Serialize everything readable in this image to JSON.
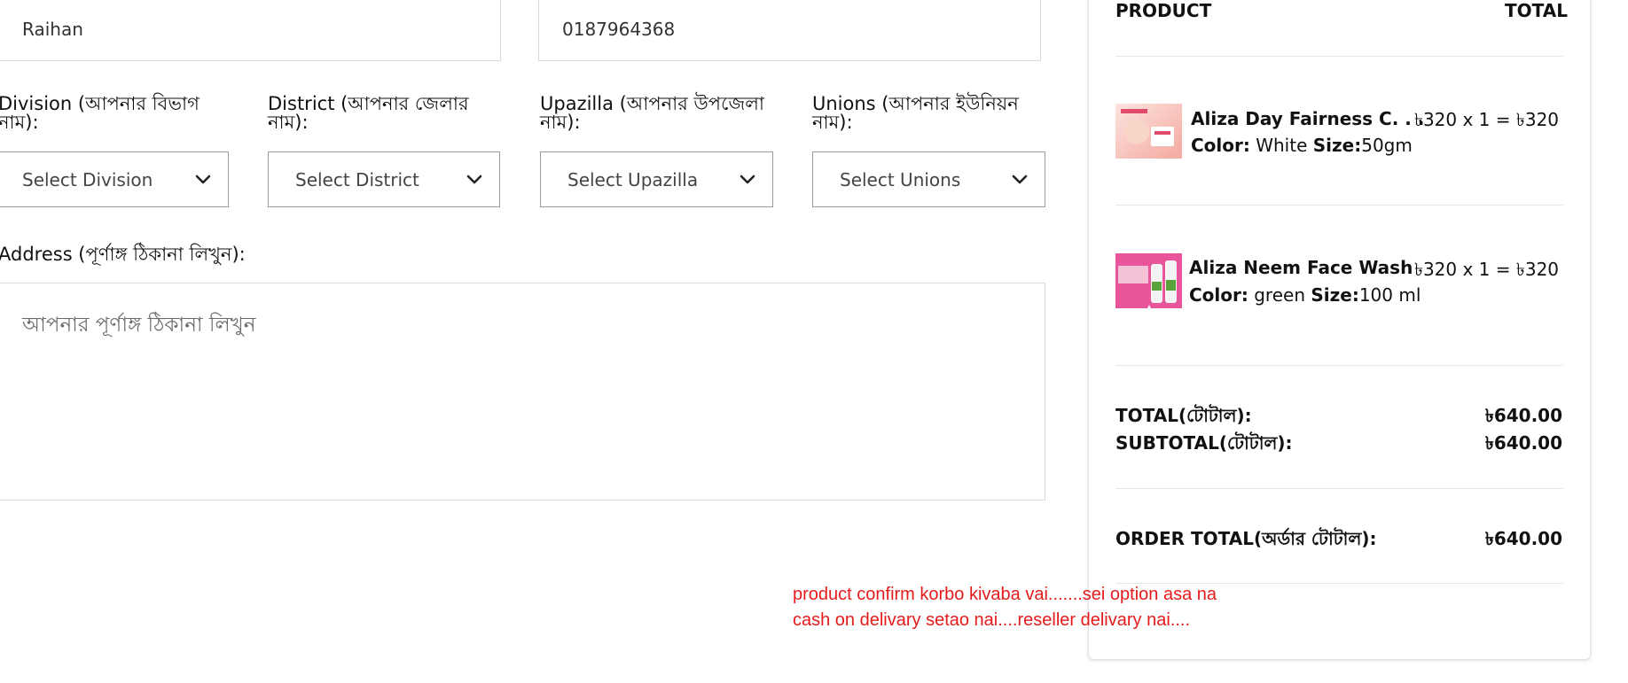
{
  "form": {
    "name_value": "Raihan",
    "phone_value": "0187964368",
    "division_label_1": "Division (আপনার বিভাগ",
    "division_label_2": "নাম):",
    "district_label_1": "District (আপনার জেলার",
    "district_label_2": "নাম):",
    "upazilla_label_1": "Upazilla (আপনার উপজেলা",
    "upazilla_label_2": "নাম):",
    "unions_label_1": "Unions (আপনার ইউনিয়ন",
    "unions_label_2": "নাম):",
    "division_select": "Select Division",
    "district_select": "Select District",
    "upazilla_select": "Select Upazilla",
    "unions_select": "Select Unions",
    "address_label": "Address (পূর্ণাঙ্গ ঠিকানা লিখুন):",
    "address_placeholder": "আপনার পূর্ণাঙ্গ ঠিকানা লিখুন"
  },
  "summary": {
    "header_product": "PRODUCT",
    "header_total": "TOTAL",
    "items": [
      {
        "name": "Aliza Day Fairness C. . .",
        "price": "৳320 x 1 = ৳320",
        "color_label": "Color:",
        "color_value": "White",
        "size_label": "Size:",
        "size_value": "50gm"
      },
      {
        "name": "Aliza Neem Face Wash",
        "price": "৳320 x 1 = ৳320",
        "color_label": "Color:",
        "color_value": "green",
        "size_label": "Size:",
        "size_value": "100 ml"
      }
    ],
    "total_label": "TOTAL(টোটাল):",
    "total_value": "৳640.00",
    "subtotal_label": "SUBTOTAL(টোটাল):",
    "subtotal_value": "৳640.00",
    "order_total_label": "ORDER TOTAL(অর্ডার টোটাল):",
    "order_total_value": "৳640.00"
  },
  "annotation": {
    "line1": "product confirm korbo kivaba vai.......sei option asa na",
    "line2": "cash on delivary setao nai....reseller delivary nai...."
  },
  "colors": {
    "annotation": "#e51b1b",
    "product1_thumb": "#f6c9c2",
    "product2_thumb": "#e8559a"
  }
}
